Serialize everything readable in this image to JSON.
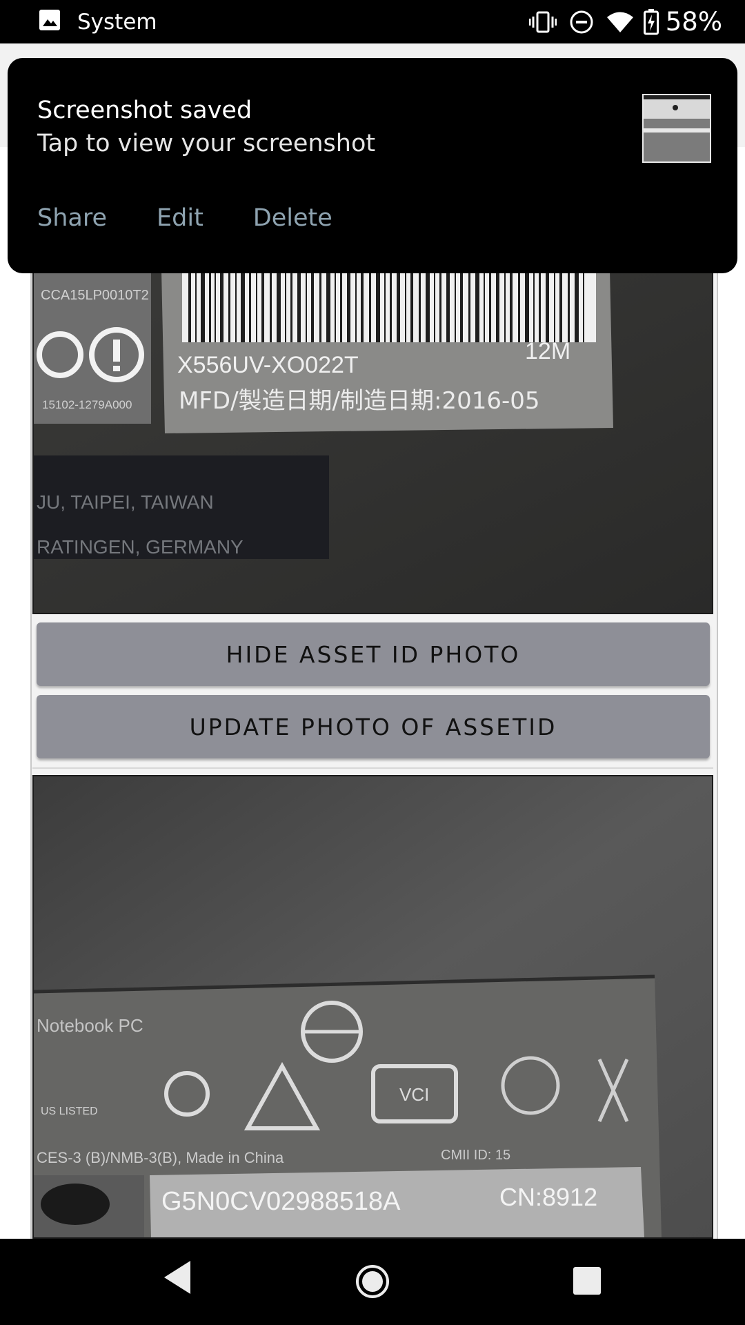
{
  "status_bar": {
    "title": "System",
    "battery_percent": "58%",
    "icons": [
      "image-icon",
      "vibrate-icon",
      "do-not-disturb-icon",
      "wifi-icon",
      "battery-charging-icon"
    ]
  },
  "notification": {
    "title": "Screenshot saved",
    "text": "Tap to view your screenshot",
    "actions": [
      "Share",
      "Edit",
      "Delete"
    ]
  },
  "buttons": {
    "hide_asset_photo": "HIDE ASSET ID PHOTO",
    "update_asset_photo": "UPDATE PHOTO OF ASSETID"
  },
  "photo_1": {
    "label_model": "X556UV-XO022T",
    "label_suffix": "12M",
    "label_mfd": "MFD/製造日期/制造日期:2016-05",
    "label_code": "CCA15LP0010T2",
    "label_batch": "15102-1279A000",
    "text_taipei": "JU, TAIPEI, TAIWAN",
    "text_ratingen": "RATINGEN, GERMANY"
  },
  "photo_2": {
    "label_notebook": "Notebook PC",
    "label_made_in": "CES-3 (B)/NMB-3(B), Made in China",
    "label_serial": "G5N0CV02988518A",
    "label_cn": "CN:8912",
    "label_ul": "US LISTED",
    "label_cmii": "CMII ID: 15"
  },
  "nav_bar": {
    "icons": [
      "back-icon",
      "home-icon",
      "recents-icon"
    ]
  },
  "colors": {
    "status_bar": "#000000",
    "button_bg": "#8e8f97",
    "notification_bg": "#000000",
    "notification_action": "#8ea3b0"
  }
}
